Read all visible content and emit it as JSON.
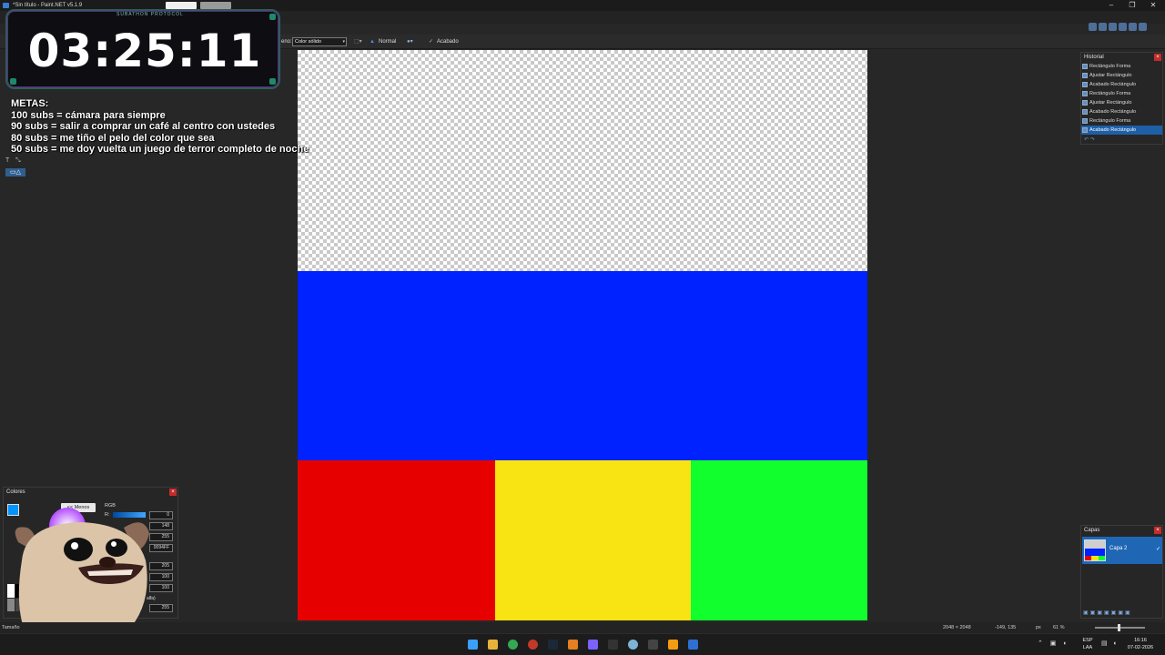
{
  "window": {
    "title": "*Sin título - Paint.NET v5.1.9",
    "controls": [
      "–",
      "❐",
      "✕"
    ]
  },
  "toolbar": {
    "fill_label": "eno:",
    "fill_value": "Color sólido",
    "blend_mode": "Normal",
    "finish_label": "Acabado"
  },
  "overlay": {
    "timer": "03:25:11",
    "timer_tag": "SUBATHON PROTOCOL",
    "goals_title": "METAS:",
    "goals": [
      "100 subs = cámara para siempre",
      "90 subs = salir a comprar un café al centro con ustedes",
      "80 subs = me tiño el pelo del color que sea",
      "50 subs = me doy vuelta un juego de terror completo de noche"
    ]
  },
  "canvas": {
    "bands": [
      {
        "name": "transparent-band",
        "color": "checker"
      },
      {
        "name": "blue-band",
        "color": "#0022ff"
      },
      {
        "name": "red-block",
        "color": "#e60000"
      },
      {
        "name": "yellow-block",
        "color": "#f8e412"
      },
      {
        "name": "green-block",
        "color": "#12ff2e"
      }
    ]
  },
  "history": {
    "title": "Historial",
    "items": [
      "Rectángulo Forma",
      "Ajustar Rectángulo",
      "Acabado Rectángulo",
      "Rectángulo Forma",
      "Ajustar Rectángulo",
      "Acabado Rectángulo",
      "Rectángulo Forma",
      "Acabado Rectángulo"
    ],
    "selected_index": 7
  },
  "layers": {
    "title": "Capas",
    "items": [
      "Capa 2"
    ]
  },
  "colors": {
    "title": "Colores",
    "less_button": "<< Menos",
    "mode": "RGB",
    "r_label": "R:",
    "fields": [
      "0",
      "148",
      "255",
      "0094FF",
      "205",
      "100",
      "100",
      "255"
    ],
    "alpha_label": "alfa)",
    "primary_color": "#0094ff"
  },
  "status": {
    "left": "Tamaño",
    "image_size": "2048 × 2048",
    "cursor": "-149, 135",
    "units": "px",
    "zoom": "61 %"
  },
  "taskbar": {
    "lang_top": "ESP",
    "lang_bottom": "LAA",
    "time": "16:16",
    "date": "07-02-2026"
  }
}
